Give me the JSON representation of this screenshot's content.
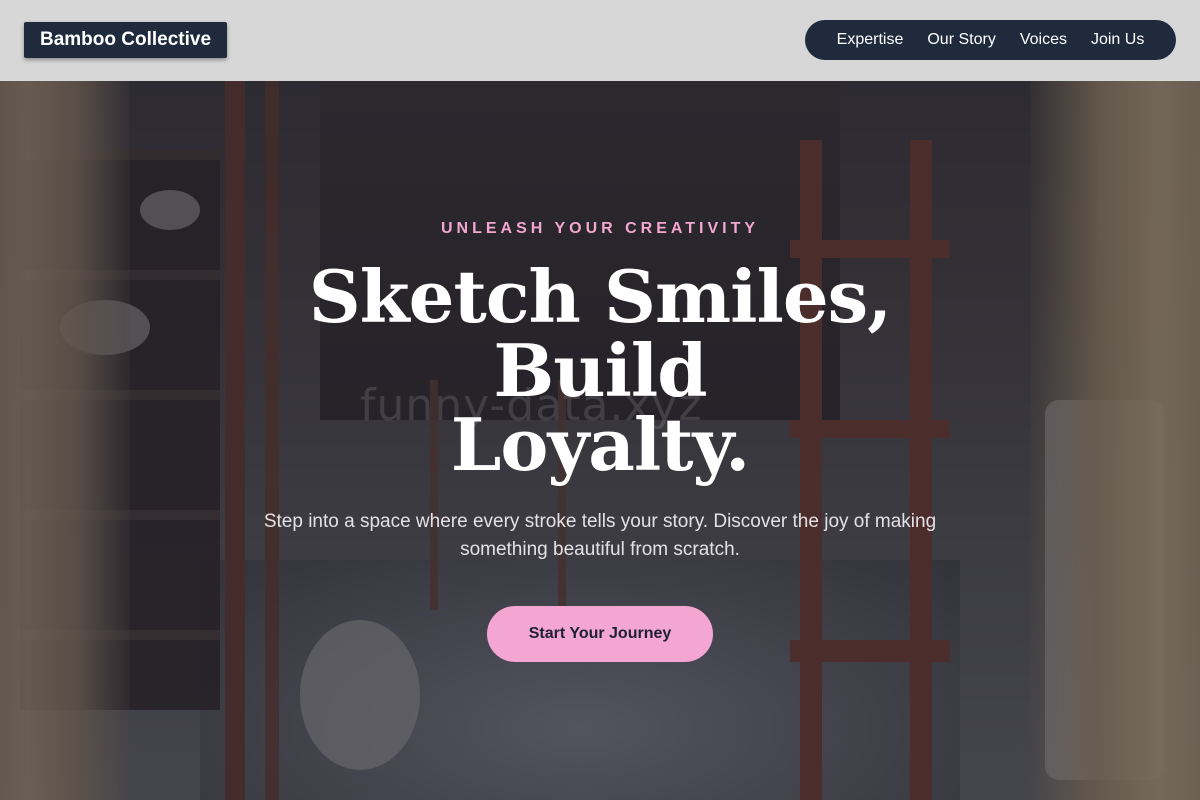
{
  "header": {
    "brand": "Bamboo Collective",
    "nav": [
      {
        "label": "Expertise"
      },
      {
        "label": "Our Story"
      },
      {
        "label": "Voices"
      },
      {
        "label": "Join Us"
      }
    ]
  },
  "hero": {
    "eyebrow": "UNLEASH YOUR CREATIVITY",
    "headline_line1": "Sketch Smiles, Build",
    "headline_line2": "Loyalty.",
    "subtext": "Step into a space where every stroke tells your story. Discover the joy of making something beautiful from scratch.",
    "cta_label": "Start Your Journey",
    "watermark": "funny-data.xyz",
    "background_image": "art-studio-interior"
  },
  "colors": {
    "header_bg": "#e4e4e4",
    "brand_bg": "#1f2b3c",
    "accent_pink": "#f4a6d3",
    "eyebrow_pink": "#f3a6cf",
    "headline": "#ffffff"
  }
}
